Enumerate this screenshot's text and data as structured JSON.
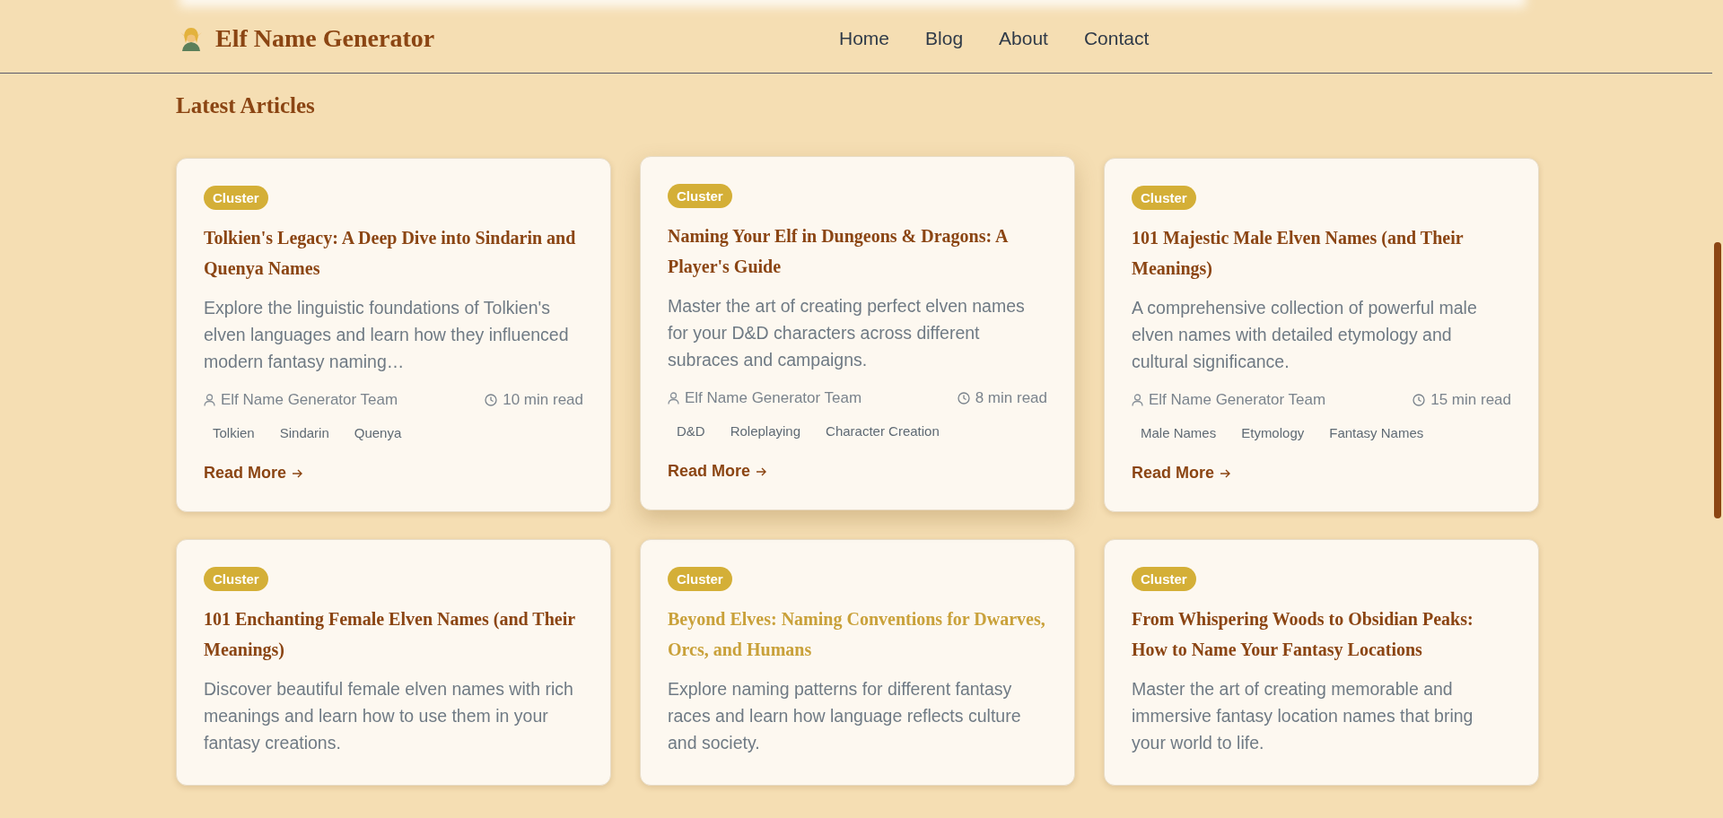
{
  "header": {
    "logo_text": "Elf Name Generator",
    "nav": [
      {
        "label": "Home"
      },
      {
        "label": "Blog"
      },
      {
        "label": "About"
      },
      {
        "label": "Contact"
      }
    ]
  },
  "section_title": "Latest Articles",
  "articles": [
    {
      "badge": "Cluster",
      "title": "Tolkien's Legacy: A Deep Dive into Sindarin and Quenya Names",
      "description": "Explore the linguistic foundations of Tolkien's elven languages and learn how they influenced modern fantasy naming…",
      "author": "Elf Name Generator Team",
      "read_time": "10 min read",
      "tags": [
        "Tolkien",
        "Sindarin",
        "Quenya"
      ],
      "link": "Read More",
      "hovered": false,
      "title_hovered": false
    },
    {
      "badge": "Cluster",
      "title": "Naming Your Elf in Dungeons & Dragons: A Player's Guide",
      "description": "Master the art of creating perfect elven names for your D&D characters across different subraces and campaigns.",
      "author": "Elf Name Generator Team",
      "read_time": "8 min read",
      "tags": [
        "D&D",
        "Roleplaying",
        "Character Creation"
      ],
      "link": "Read More",
      "hovered": true,
      "title_hovered": false
    },
    {
      "badge": "Cluster",
      "title": "101 Majestic Male Elven Names (and Their Meanings)",
      "description": "A comprehensive collection of powerful male elven names with detailed etymology and cultural significance.",
      "author": "Elf Name Generator Team",
      "read_time": "15 min read",
      "tags": [
        "Male Names",
        "Etymology",
        "Fantasy Names"
      ],
      "link": "Read More",
      "hovered": false,
      "title_hovered": false
    },
    {
      "badge": "Cluster",
      "title": "101 Enchanting Female Elven Names (and Their Meanings)",
      "description": "Discover beautiful female elven names with rich meanings and learn how to use them in your fantasy creations.",
      "hovered": false,
      "title_hovered": false
    },
    {
      "badge": "Cluster",
      "title": "Beyond Elves: Naming Conventions for Dwarves, Orcs, and Humans",
      "description": "Explore naming patterns for different fantasy races and learn how language reflects culture and society.",
      "hovered": false,
      "title_hovered": true
    },
    {
      "badge": "Cluster",
      "title": "From Whispering Woods to Obsidian Peaks: How to Name Your Fantasy Locations",
      "description": "Master the art of creating memorable and immersive fantasy location names that bring your world to life.",
      "hovered": false,
      "title_hovered": false
    }
  ]
}
